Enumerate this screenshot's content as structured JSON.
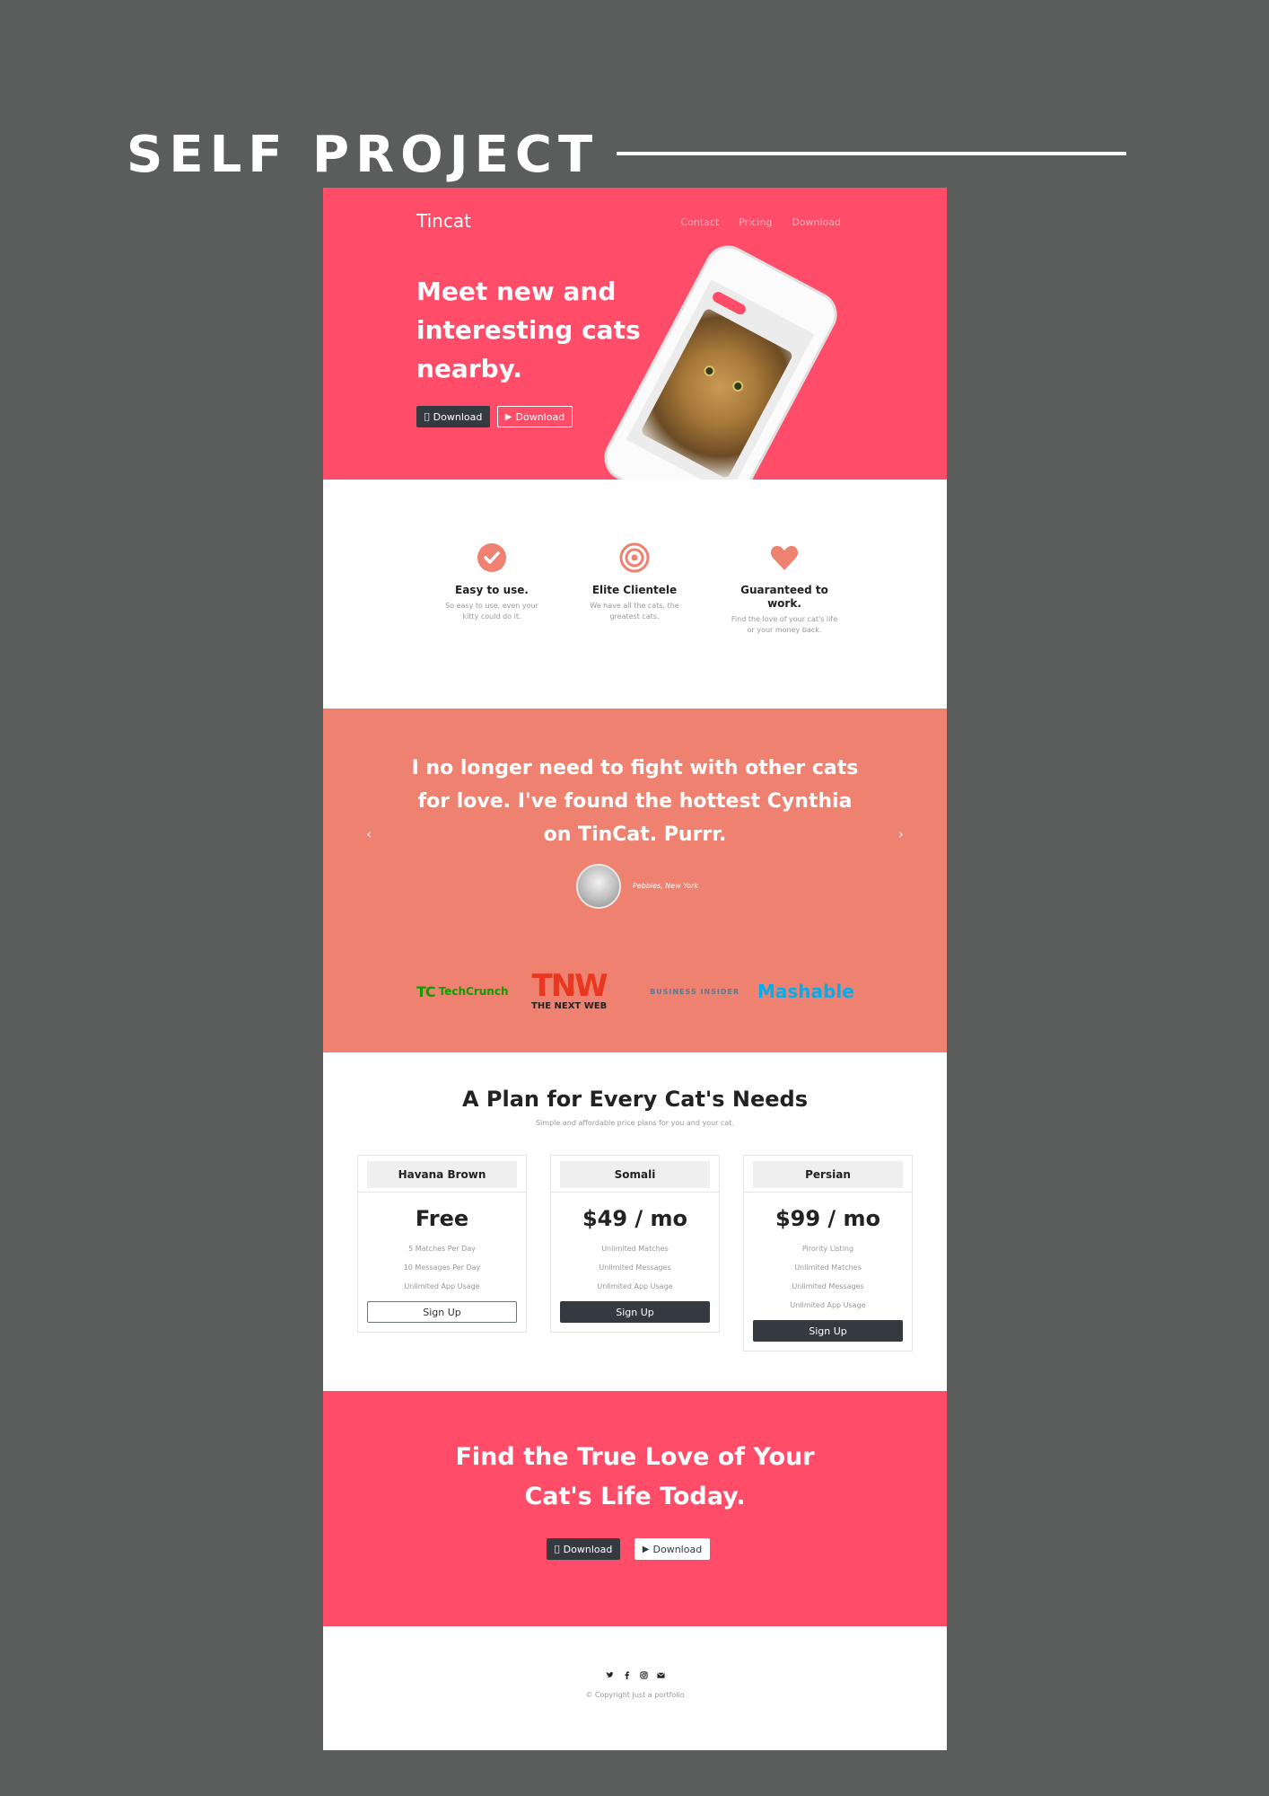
{
  "poster": {
    "title": "SELF PROJECT"
  },
  "nav": {
    "brand": "Tincat",
    "links": [
      "Contact",
      "Pricing",
      "Download"
    ]
  },
  "hero": {
    "headline": "Meet new and interesting cats nearby.",
    "download_apple": "Download",
    "download_play": "Download"
  },
  "features": [
    {
      "icon": "check-circle-icon",
      "title": "Easy to use.",
      "text": "So easy to use, even your kitty could do it."
    },
    {
      "icon": "target-icon",
      "title": "Elite Clientele",
      "text": "We have all the cats, the greatest cats."
    },
    {
      "icon": "heart-icon",
      "title": "Guaranteed to work.",
      "text": "Find the love of your cat's life or your money back."
    }
  ],
  "testimonial": {
    "quote": "I no longer need to fight with other cats for love. I've found the hottest Cynthia on TinCat. Purrr.",
    "author": "Pebbles, New York"
  },
  "press": {
    "techcrunch": "TechCrunch",
    "tnw_big": "TNW",
    "tnw_small": "THE NEXT WEB",
    "business_insider": "BUSINESS INSIDER",
    "mashable": "Mashable"
  },
  "pricing": {
    "title": "A Plan for Every Cat's Needs",
    "subtitle": "Simple and affordable price plans for you and your cat.",
    "plans": [
      {
        "name": "Havana Brown",
        "price": "Free",
        "features": [
          "5 Matches Per Day",
          "10 Messages Per Day",
          "Unlimited App Usage"
        ],
        "button": "Sign Up"
      },
      {
        "name": "Somali",
        "price": "$49 / mo",
        "features": [
          "Unlimited Matches",
          "Unlimited Messages",
          "Unlimited App Usage"
        ],
        "button": "Sign Up"
      },
      {
        "name": "Persian",
        "price": "$99 / mo",
        "features": [
          "Pirority Listing",
          "Unlimited Matches",
          "Unlimited Messages",
          "Unlimited App Usage"
        ],
        "button": "Sign Up"
      }
    ]
  },
  "cta": {
    "headline": "Find the True Love of Your Cat's Life Today.",
    "download_apple": "Download",
    "download_play": "Download"
  },
  "footer": {
    "copyright": "© Copyright Just a portfolio"
  },
  "colors": {
    "hero": "#ff4c68",
    "testimonial": "#ef8170",
    "dark": "#343a40",
    "poster_bg": "#5b5c5c"
  }
}
